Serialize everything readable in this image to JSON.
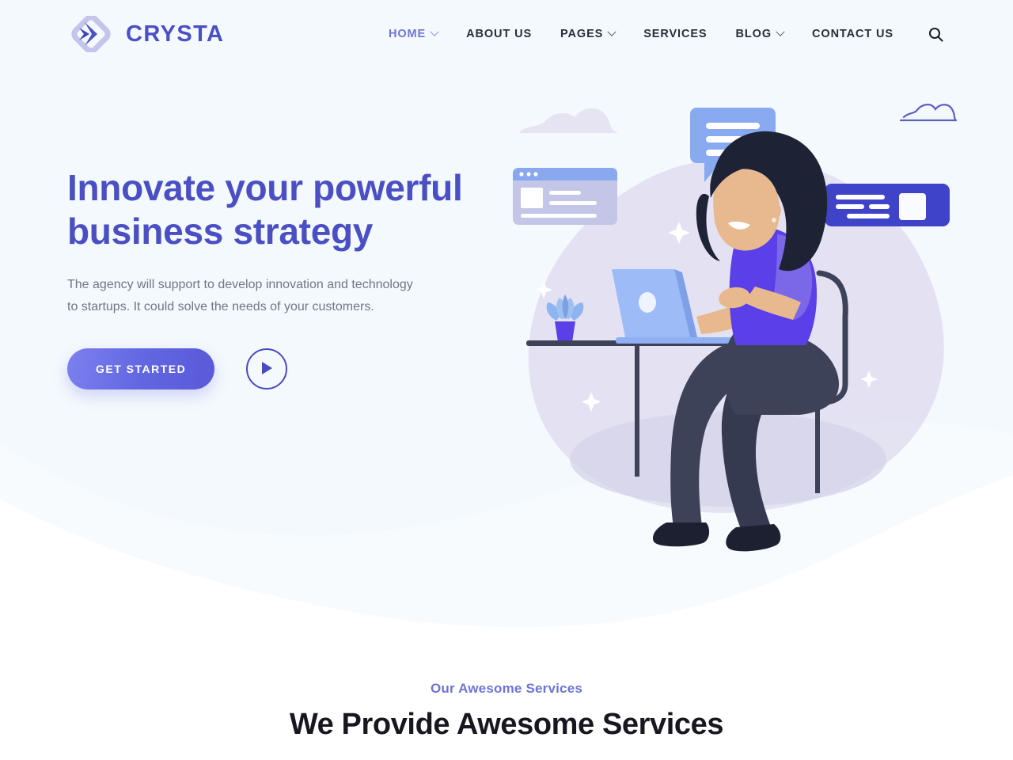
{
  "brand": {
    "name": "CRYSTA",
    "logo_icon": "diamond-arrow-logo-icon",
    "accent": "#4a4fc4"
  },
  "nav": {
    "items": [
      {
        "label": "HOME",
        "has_dropdown": true,
        "active": true
      },
      {
        "label": "ABOUT US",
        "has_dropdown": false,
        "active": false
      },
      {
        "label": "PAGES",
        "has_dropdown": true,
        "active": false
      },
      {
        "label": "SERVICES",
        "has_dropdown": false,
        "active": false
      },
      {
        "label": "BLOG",
        "has_dropdown": true,
        "active": false
      },
      {
        "label": "CONTACT US",
        "has_dropdown": false,
        "active": false
      }
    ],
    "search_icon": "search-icon"
  },
  "hero": {
    "title": "Innovate your powerful business strategy",
    "subtitle": "The agency will support to develop innovation and technology to startups. It could solve the needs of your customers.",
    "primary_cta": "GET STARTED",
    "play_icon": "play-icon",
    "bg_color": "#f4f9fd",
    "title_color": "#4a4fc4"
  },
  "illustration": {
    "name": "woman-working-at-desk-illustration",
    "elements": [
      "cloud-filled-shape",
      "chat-bubble-card",
      "browser-window-card",
      "dark-purple-info-card",
      "cloud-outline-shape",
      "potted-plant",
      "laptop",
      "desk",
      "chair",
      "woman-figure",
      "sparkle-stars"
    ],
    "colors": {
      "blob": "#e0def0",
      "chat_bubble": "#88aaf0",
      "browser_header": "#8aa8f0",
      "browser_body": "#c3c6e6",
      "info_card": "#3f43c8",
      "laptop": "#8fb0f2",
      "shirt": "#5b3fe8",
      "sleeve": "#7b68e8",
      "hair": "#1e2235",
      "skin": "#e8b98f",
      "pants": "#3d4258",
      "shoes": "#1c2030",
      "pot": "#5b3fe8",
      "leaves": "#7fa8ee"
    }
  },
  "services": {
    "eyebrow": "Our Awesome Services",
    "title": "We Provide Awesome Services",
    "eyebrow_color": "#6d74d8"
  }
}
